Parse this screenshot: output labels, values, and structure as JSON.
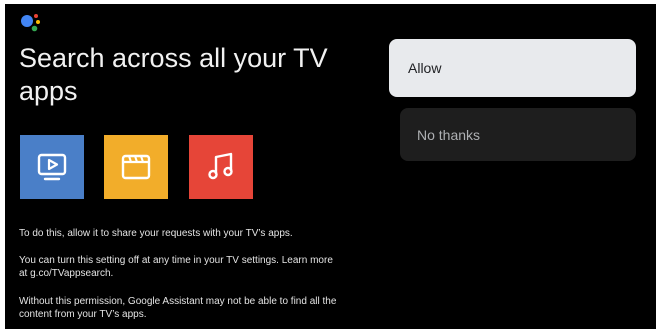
{
  "assistant": {
    "icon": "google-assistant-icon",
    "dot_colors": [
      "#4285f4",
      "#ea4335",
      "#fbbc05",
      "#34a853"
    ]
  },
  "dialog": {
    "title": "Search across all your TV apps",
    "tiles": [
      {
        "icon": "video-icon",
        "color": "#4a7fc8"
      },
      {
        "icon": "clapperboard-icon",
        "color": "#f2ad2a"
      },
      {
        "icon": "music-note-icon",
        "color": "#e64538"
      }
    ],
    "paragraphs": [
      "To do this, allow it to share your requests with your TV’s apps.",
      "You can turn this setting off at any time in your TV settings. Learn more at g.co/TVappsearch.",
      "Without this permission, Google Assistant may not be able to find all the content from your TV’s apps."
    ]
  },
  "actions": {
    "allow_label": "Allow",
    "decline_label": "No thanks"
  }
}
